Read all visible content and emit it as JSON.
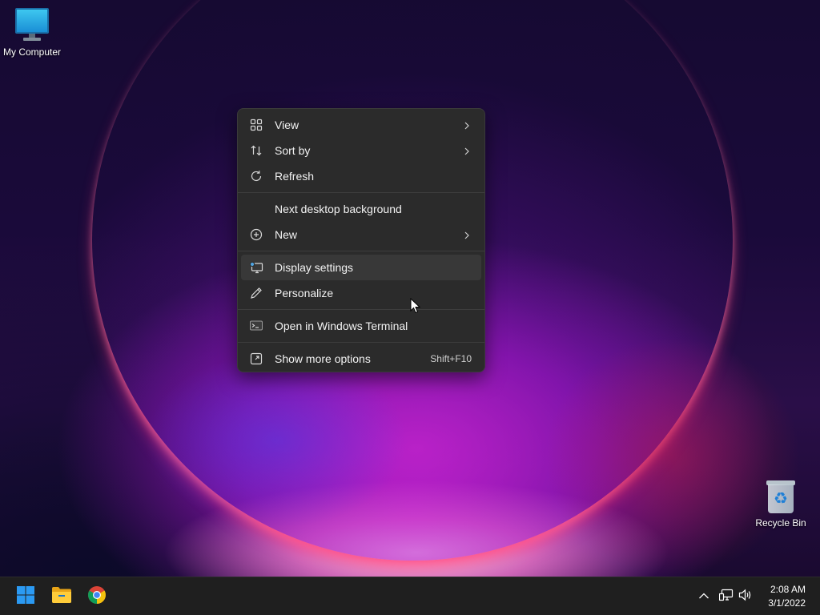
{
  "desktop": {
    "icons": [
      {
        "label": "My Computer",
        "icon": "monitor-icon"
      },
      {
        "label": "Recycle Bin",
        "icon": "recycle-bin-icon"
      }
    ]
  },
  "context_menu": {
    "items": [
      {
        "label": "View",
        "icon": "grid-icon",
        "submenu": true
      },
      {
        "label": "Sort by",
        "icon": "sort-icon",
        "submenu": true
      },
      {
        "label": "Refresh",
        "icon": "refresh-icon"
      },
      {
        "label": "Next desktop background",
        "icon": ""
      },
      {
        "label": "New",
        "icon": "plus-circle-icon",
        "submenu": true
      },
      {
        "label": "Display settings",
        "icon": "display-settings-icon",
        "highlighted": true
      },
      {
        "label": "Personalize",
        "icon": "pen-icon"
      },
      {
        "label": "Open in Windows Terminal",
        "icon": "terminal-icon"
      },
      {
        "label": "Show more options",
        "icon": "expand-icon",
        "shortcut": "Shift+F10"
      }
    ]
  },
  "taskbar": {
    "apps": [
      {
        "name": "start-button",
        "icon": "windows-logo-icon"
      },
      {
        "name": "file-explorer",
        "icon": "folder-icon"
      },
      {
        "name": "chrome",
        "icon": "chrome-icon"
      }
    ],
    "tray": {
      "icons": [
        "chevron-up-icon",
        "network-icon",
        "volume-icon"
      ]
    },
    "clock": {
      "time": "2:08 AM",
      "date": "3/1/2022"
    }
  },
  "colors": {
    "menu_bg": "#2b2b2b",
    "menu_hover": "#383838",
    "taskbar_bg": "#1f1f1f",
    "windows_blue": "#2b9af3"
  }
}
